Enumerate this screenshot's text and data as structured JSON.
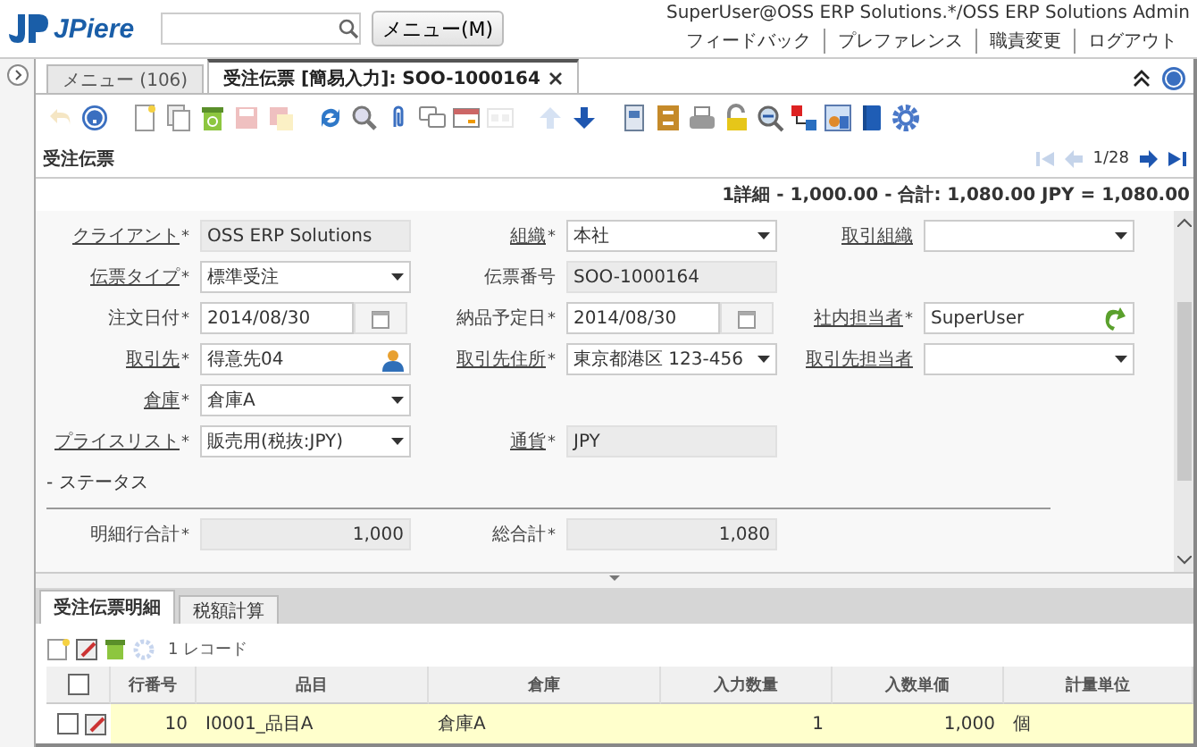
{
  "header": {
    "logo": "JPiere",
    "menu_button": "メニュー(M)",
    "user": "SuperUser@OSS ERP Solutions.*/OSS ERP Solutions Admin",
    "links": [
      "フィードバック",
      "プレファレンス",
      "職責変更",
      "ログアウト"
    ]
  },
  "tabs": [
    {
      "label": "メニュー (106)",
      "selected": false,
      "closable": false
    },
    {
      "label": "受注伝票 [簡易入力]: SOO-1000164",
      "selected": true,
      "closable": true
    }
  ],
  "toolbar": [
    {
      "kind": "undo",
      "disabled": true
    },
    {
      "kind": "help",
      "disabled": false
    },
    {
      "kind": "sep"
    },
    {
      "kind": "new",
      "disabled": false
    },
    {
      "kind": "copy",
      "disabled": false
    },
    {
      "kind": "delete",
      "disabled": false
    },
    {
      "kind": "save",
      "disabled": true
    },
    {
      "kind": "savenew",
      "disabled": true
    },
    {
      "kind": "sep"
    },
    {
      "kind": "refresh",
      "disabled": false
    },
    {
      "kind": "find",
      "disabled": false
    },
    {
      "kind": "attach",
      "disabled": false
    },
    {
      "kind": "chat",
      "disabled": false
    },
    {
      "kind": "grid",
      "disabled": false
    },
    {
      "kind": "form",
      "disabled": true
    },
    {
      "kind": "sep"
    },
    {
      "kind": "up",
      "disabled": true
    },
    {
      "kind": "down",
      "disabled": false
    },
    {
      "kind": "sep"
    },
    {
      "kind": "report",
      "disabled": false
    },
    {
      "kind": "archive",
      "disabled": false
    },
    {
      "kind": "print",
      "disabled": false
    },
    {
      "kind": "lock",
      "disabled": false
    },
    {
      "kind": "zoom",
      "disabled": false
    },
    {
      "kind": "workflow",
      "disabled": false
    },
    {
      "kind": "chart",
      "disabled": false
    },
    {
      "kind": "book",
      "disabled": false
    },
    {
      "kind": "gear",
      "disabled": false
    }
  ],
  "window_title": "受注伝票",
  "nav": {
    "first_disabled": true,
    "prev_disabled": true,
    "position": "1/28",
    "next_disabled": false,
    "last_disabled": false
  },
  "summary": "1詳細 - 1,000.00 - 合計: 1,080.00 JPY = 1,080.00",
  "form_rows": [
    [
      {
        "label": "クライアント",
        "required_mark": "*",
        "link": true,
        "kind": "readonly",
        "value": "OSS ERP Solutions"
      },
      {
        "label": "組織",
        "required_mark": "*",
        "link": true,
        "kind": "select",
        "value": "本社"
      },
      {
        "label": "取引組織",
        "link": true,
        "kind": "select"
      }
    ],
    [
      {
        "label": "伝票タイプ",
        "required_mark": "*",
        "link": true,
        "kind": "select",
        "value": "標準受注"
      },
      {
        "label": "伝票番号",
        "link": false,
        "kind": "readonly",
        "value": "SOO-1000164"
      }
    ],
    [
      {
        "label": "注文日付",
        "required_mark": "*",
        "link": false,
        "kind": "date",
        "value": "2014/08/30"
      },
      {
        "label": "納品予定日",
        "required_mark": "*",
        "link": false,
        "kind": "date",
        "value": "2014/08/30"
      },
      {
        "label": "社内担当者",
        "required_mark": "*",
        "link": true,
        "kind": "user",
        "value": "SuperUser"
      }
    ],
    [
      {
        "label": "取引先",
        "required_mark": "*",
        "link": true,
        "kind": "partner",
        "value": "得意先04"
      },
      {
        "label": "取引先住所",
        "required_mark": "*",
        "link": true,
        "kind": "select",
        "value": "東京都港区 123-456"
      },
      {
        "label": "取引先担当者",
        "link": true,
        "kind": "select"
      }
    ],
    [
      {
        "label": "倉庫",
        "required_mark": "*",
        "link": true,
        "kind": "select",
        "value": "倉庫A"
      }
    ],
    [
      {
        "label": "プライスリスト",
        "required_mark": "*",
        "link": true,
        "kind": "select",
        "value": "販売用(税抜:JPY)"
      },
      {
        "label": "通貨",
        "required_mark": "*",
        "link": true,
        "kind": "readonly",
        "value": "JPY"
      }
    ]
  ],
  "status_group": {
    "label": "- ステータス"
  },
  "totals": [
    {
      "label": "明細行合計",
      "required_mark": "*",
      "value": "1,000"
    },
    {
      "label": "総合計",
      "required_mark": "*",
      "value": "1,080"
    }
  ],
  "detail_tabs": [
    {
      "label": "受注伝票明細",
      "selected": true
    },
    {
      "label": "税額計算",
      "selected": false
    }
  ],
  "detail_toolbar": {
    "record_count": "1 レコード"
  },
  "grid": {
    "all_checked": false,
    "columns": [
      "行番号",
      "品目",
      "倉庫",
      "入力数量",
      "入数単価",
      "計量単位"
    ],
    "rows": [
      {
        "checked": false,
        "cells": [
          "10",
          "I0001_品目A",
          "倉庫A",
          "1",
          "1,000",
          "個"
        ]
      }
    ]
  }
}
